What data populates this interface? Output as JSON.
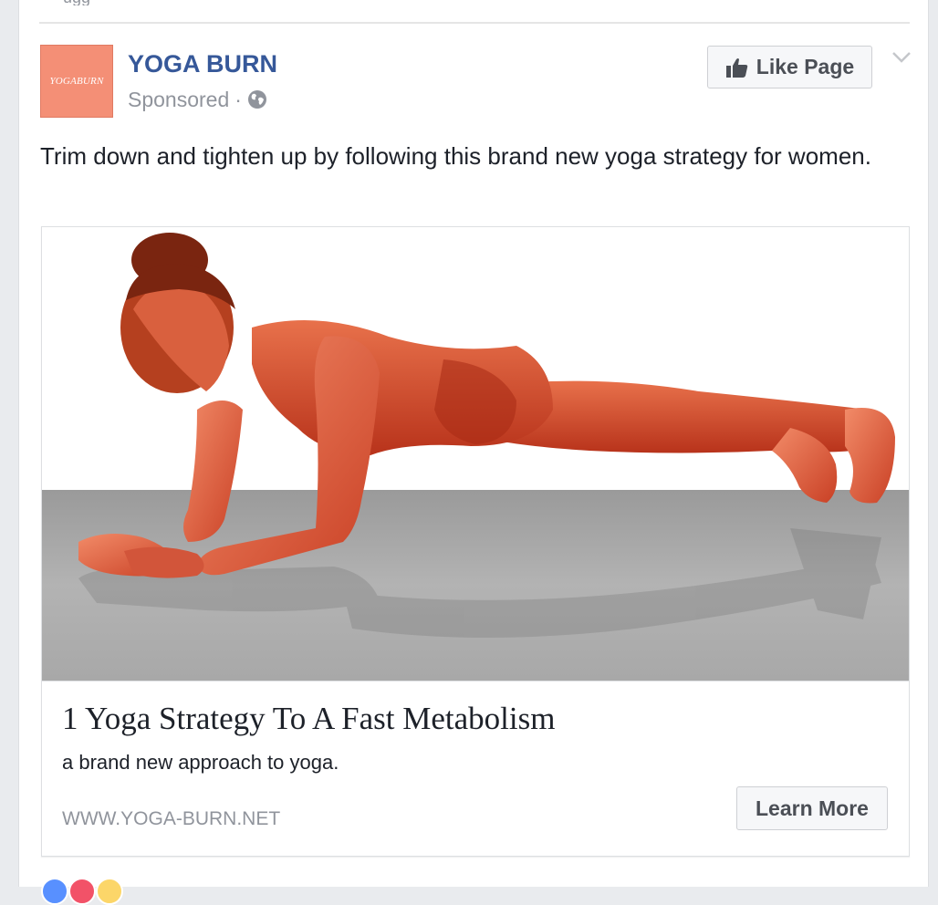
{
  "previous_post": {
    "partial_text": "ugg"
  },
  "post": {
    "page_name": "YOGA BURN",
    "avatar_logo_text": "YOGABURN",
    "sponsored_label": "Sponsored",
    "separator": "·",
    "privacy_icon": "globe-icon",
    "like_page_label": "Like Page",
    "like_icon": "thumbs-up-icon",
    "options_icon": "chevron-down-icon",
    "text": "Trim down and tighten up by following this brand new yoga strategy for women."
  },
  "link_preview": {
    "image_subject": "plank-pose-illustration",
    "title": "1 Yoga Strategy To A Fast Metabolism",
    "description": "a brand new approach to yoga.",
    "domain": "WWW.YOGA-BURN.NET",
    "cta_label": "Learn More"
  },
  "reactions": {
    "icons": [
      "like-reaction-icon",
      "love-reaction-icon",
      "haha-reaction-icon"
    ]
  },
  "colors": {
    "page_name": "#365899",
    "avatar_bg": "#f48f76",
    "meta_text": "#90949c",
    "button_bg": "#f6f7f9",
    "button_text": "#4b4f56",
    "reaction_like": "#5890ff",
    "reaction_love": "#f25268",
    "reaction_haha": "#fcd669"
  }
}
